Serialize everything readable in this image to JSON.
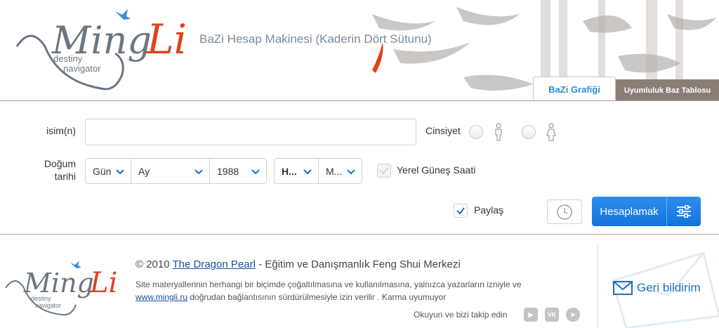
{
  "header": {
    "logo": {
      "brand": "Ming Li",
      "tagline_1": "destiny",
      "tagline_2": "navigator"
    },
    "title": "BaZi Hesap Makinesi (Kaderin Dört Sütunu)",
    "tabs": [
      {
        "label": "BaZi Grafiği",
        "active": true
      },
      {
        "label": "Uyumluluk Baz Tablosu",
        "active": false
      }
    ]
  },
  "form": {
    "name_label": "isim(n)",
    "name_value": "",
    "gender_label": "Cinsiyet",
    "gender_options": [
      "male-icon",
      "female-icon"
    ],
    "birth_label_1": "Doğum",
    "birth_label_2": "tarihi",
    "day": "Gün",
    "month": "Ay",
    "year": "1988",
    "hour": "H...",
    "minute": "M...",
    "local_solar_time_label": "Yerel Güneş Saati",
    "local_solar_time_checked": false,
    "share_label": "Paylaş",
    "share_checked": true,
    "calculate_label": "Hesaplamak"
  },
  "footer": {
    "copyright_prefix": "© 2010",
    "copyright_link": "The Dragon Pearl",
    "copyright_suffix": "- Eğitim ve Danışmanlık Feng Shui Merkezi",
    "notice_1": "Site materyallerinin herhangi bir biçimde çoğaltılmasına ve kullanılmasına, yalnızca yazarların izniyle ve",
    "notice_link": "www.mingli.ru",
    "notice_2": "doğrudan bağlantısının sürdürülmesiyle izin verilir . Karma uyumuyor",
    "follow_label": "Okuyun ve bizi takip edin",
    "social": [
      "youtube-icon",
      "vk-icon",
      "telegram-icon"
    ],
    "feedback_label": "Geri bildirim"
  },
  "colors": {
    "accent_blue": "#1f80e4",
    "tab_inactive": "#8a7e74",
    "logo_red": "#e0421c",
    "logo_gray": "#6b7683"
  }
}
